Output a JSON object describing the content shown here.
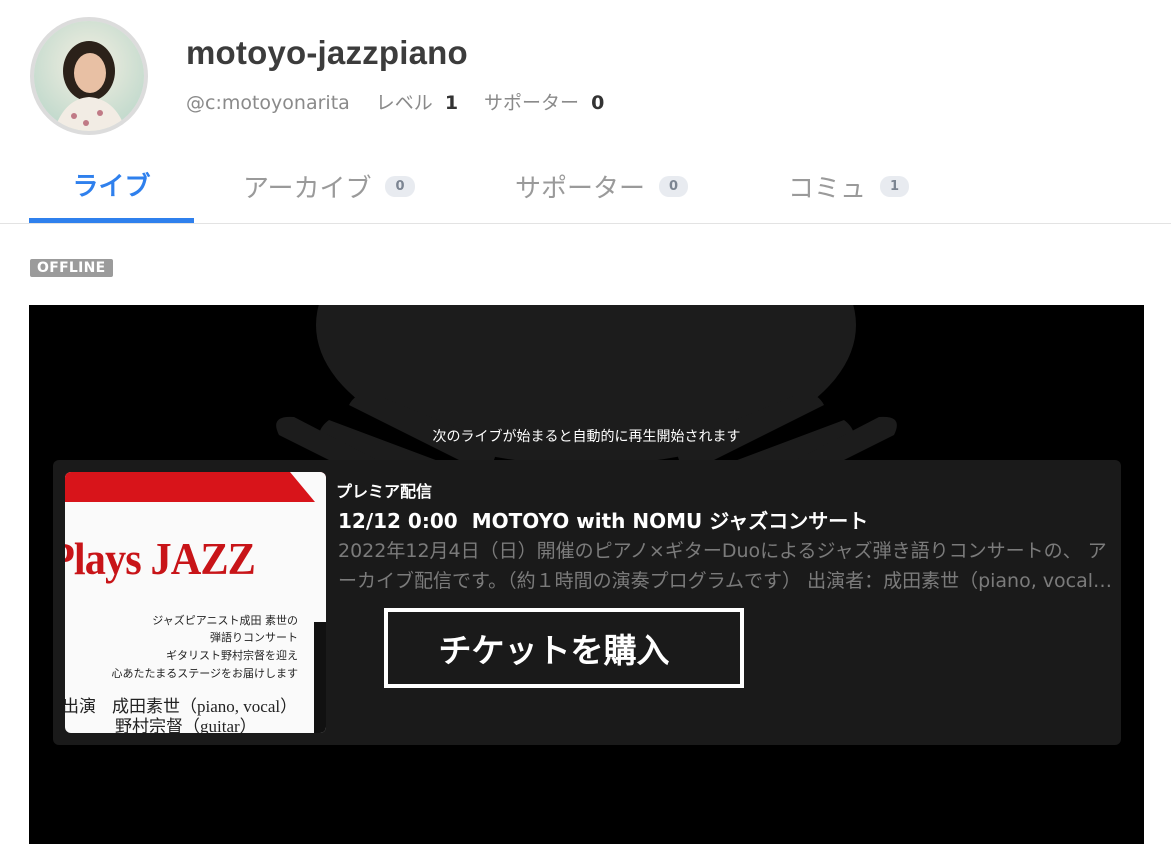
{
  "channel": {
    "name": "motoyo-jazzpiano",
    "handle": "@c:motoyonarita",
    "level_label": "レベル",
    "level_value": "1",
    "supporters_label": "サポーター",
    "supporters_value": "0"
  },
  "tabs": [
    {
      "label": "ライブ"
    },
    {
      "label": "アーカイブ",
      "count": "0"
    },
    {
      "label": "サポーター",
      "count": "0"
    },
    {
      "label": "コミュ",
      "count": "1"
    }
  ],
  "status_badge": "OFFLINE",
  "player": {
    "notice": "次のライブが始まると自動的に再生開始されます",
    "card": {
      "label": "プレミア配信",
      "date": "12/12 0:00",
      "title": "MOTOYO with NOMU ジャズコンサート",
      "description": "2022年12月4日（日）開催のピアノ×ギターDuoによるジャズ弾き語りコンサートの、 アーカイブ配信です。（約１時間の演奏プログラムです） 出演者：成田素世（piano, vocal）野村宗督（guitar）",
      "button_label": "チケットを購入",
      "thumbnail": {
        "title": "Plays JAZZ",
        "lines": [
          "ジャズピアニスト成田 素世の",
          "弾語りコンサート",
          "ギタリスト野村宗督を迎え",
          "心あたたまるステージをお届けします"
        ],
        "performers_label": "出演",
        "performer1": "成田素世（piano, vocal）",
        "performer2": "野村宗督（guitar）"
      }
    }
  },
  "colors": {
    "accent": "#2f80ed",
    "badge_offline": "#9b9b9b",
    "player_bg": "#000000",
    "card_bg": "#1a1a1a",
    "thumb_red": "#d8141a"
  }
}
